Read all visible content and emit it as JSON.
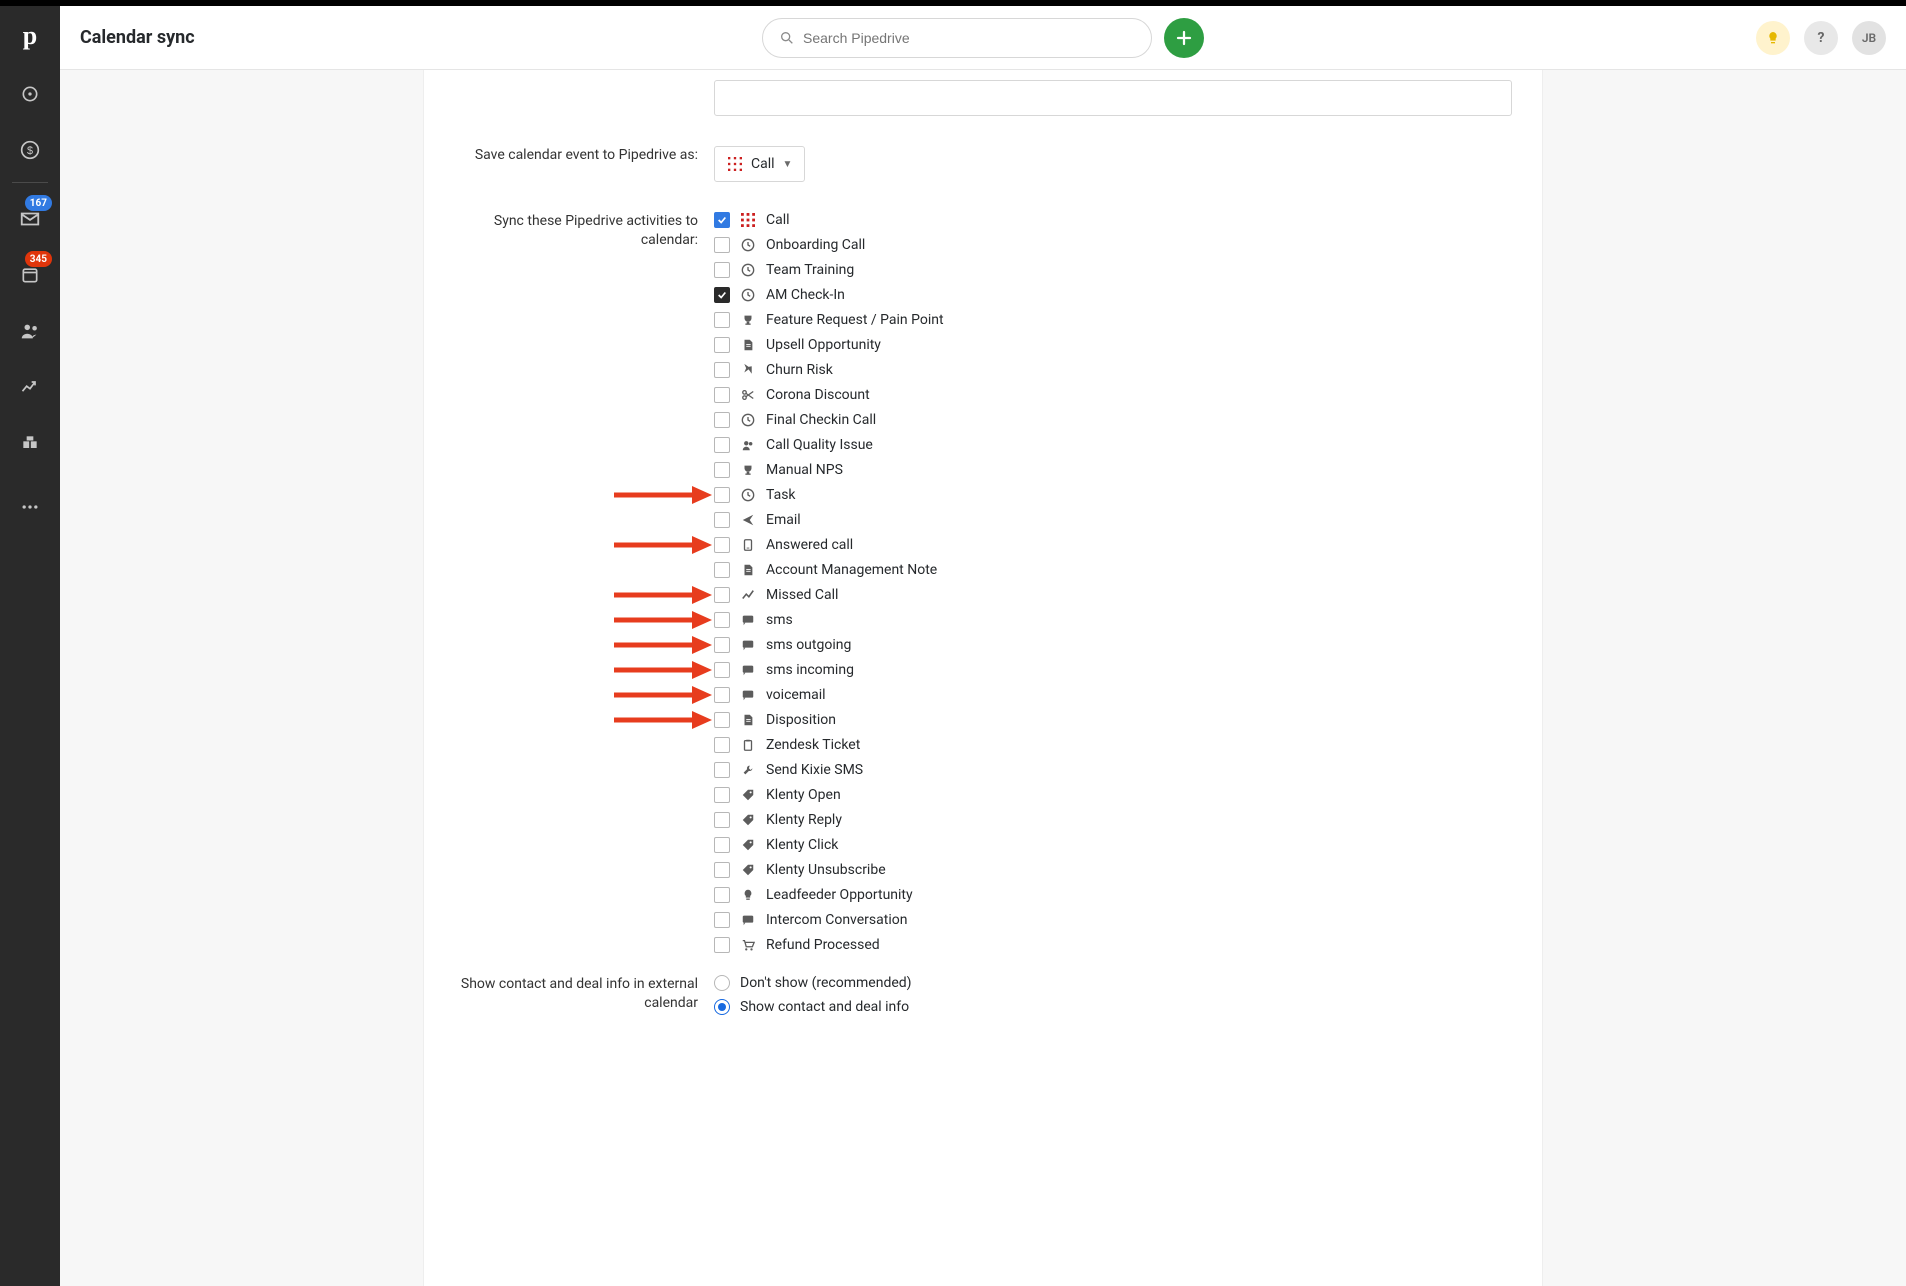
{
  "colors": {
    "accent_green": "#2e9e42",
    "badge_blue": "#317ae2",
    "badge_red": "#e0350b",
    "arrow_red": "#e73c1e",
    "call_red": "#cc2020"
  },
  "header": {
    "page_title": "Calendar sync",
    "search_placeholder": "Search Pipedrive",
    "avatar_initials": "JB"
  },
  "sidebar": {
    "mail_badge": "167",
    "activities_badge": "345"
  },
  "form": {
    "label_save_event": "Save calendar event to Pipedrive as:",
    "save_event_value": "Call",
    "label_sync_activities": "Sync these Pipedrive activities to calendar:",
    "activities": [
      {
        "label": "Call",
        "checked": "blue",
        "icon": "grid-red"
      },
      {
        "label": "Onboarding Call",
        "checked": false,
        "icon": "clock"
      },
      {
        "label": "Team Training",
        "checked": false,
        "icon": "clock"
      },
      {
        "label": "AM Check-In",
        "checked": "dark",
        "icon": "clock"
      },
      {
        "label": "Feature Request / Pain Point",
        "checked": false,
        "icon": "trophy"
      },
      {
        "label": "Upsell Opportunity",
        "checked": false,
        "icon": "doc"
      },
      {
        "label": "Churn Risk",
        "checked": false,
        "icon": "plane"
      },
      {
        "label": "Corona Discount",
        "checked": false,
        "icon": "scissors"
      },
      {
        "label": "Final Checkin Call",
        "checked": false,
        "icon": "clock"
      },
      {
        "label": "Call Quality Issue",
        "checked": false,
        "icon": "people"
      },
      {
        "label": "Manual NPS",
        "checked": false,
        "icon": "trophy"
      },
      {
        "label": "Task",
        "checked": false,
        "icon": "clock",
        "arrow": true
      },
      {
        "label": "Email",
        "checked": false,
        "icon": "send"
      },
      {
        "label": "Answered call",
        "checked": false,
        "icon": "phone-frame",
        "arrow": true
      },
      {
        "label": "Account Management Note",
        "checked": false,
        "icon": "doc"
      },
      {
        "label": "Missed Call",
        "checked": false,
        "icon": "spark",
        "arrow": true
      },
      {
        "label": "sms",
        "checked": false,
        "icon": "chat",
        "arrow": true
      },
      {
        "label": "sms outgoing",
        "checked": false,
        "icon": "chat",
        "arrow": true
      },
      {
        "label": "sms incoming",
        "checked": false,
        "icon": "chat",
        "arrow": true
      },
      {
        "label": "voicemail",
        "checked": false,
        "icon": "chat",
        "arrow": true
      },
      {
        "label": "Disposition",
        "checked": false,
        "icon": "doc",
        "arrow": true
      },
      {
        "label": "Zendesk Ticket",
        "checked": false,
        "icon": "clipboard"
      },
      {
        "label": "Send Kixie SMS",
        "checked": false,
        "icon": "wrench"
      },
      {
        "label": "Klenty Open",
        "checked": false,
        "icon": "tag"
      },
      {
        "label": "Klenty Reply",
        "checked": false,
        "icon": "tag"
      },
      {
        "label": "Klenty Click",
        "checked": false,
        "icon": "tag"
      },
      {
        "label": "Klenty Unsubscribe",
        "checked": false,
        "icon": "tag"
      },
      {
        "label": "Leadfeeder Opportunity",
        "checked": false,
        "icon": "bulb"
      },
      {
        "label": "Intercom Conversation",
        "checked": false,
        "icon": "chat"
      },
      {
        "label": "Refund Processed",
        "checked": false,
        "icon": "cart"
      }
    ],
    "label_show_info": "Show contact and deal info in external calendar",
    "radio_options": [
      {
        "label": "Don't show (recommended)",
        "checked": false
      },
      {
        "label": "Show contact and deal info",
        "checked": true
      }
    ]
  }
}
